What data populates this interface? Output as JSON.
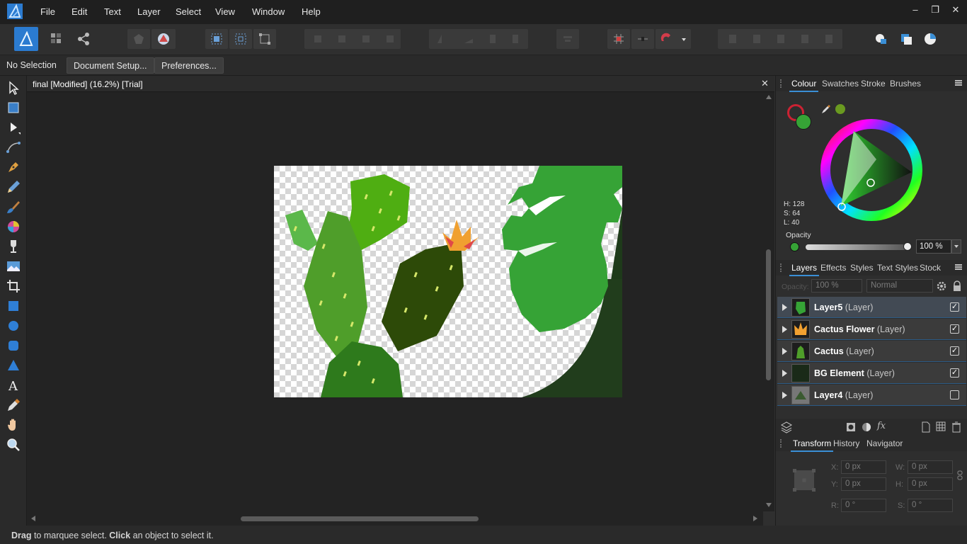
{
  "menu": [
    "File",
    "Edit",
    "Text",
    "Layer",
    "Select",
    "View",
    "Window",
    "Help"
  ],
  "window_controls": {
    "minimize": "–",
    "restore": "❐",
    "close": "✕"
  },
  "context": {
    "selection": "No Selection",
    "doc_setup": "Document Setup...",
    "preferences": "Preferences..."
  },
  "document": {
    "tab_title": "final [Modified] (16.2%) [Trial]",
    "close": "✕"
  },
  "status": {
    "drag": "Drag",
    "text1": " to marquee select. ",
    "click": "Click",
    "text2": " an object to select it."
  },
  "colour_panel": {
    "tabs": [
      "Colour",
      "Swatches",
      "Stroke",
      "Brushes"
    ],
    "h": "H: 128",
    "s": "S: 64",
    "l": "L: 40",
    "opacity_label": "Opacity",
    "opacity_value": "100 %",
    "current_colour": "#36a336"
  },
  "layers_panel": {
    "tabs": [
      "Layers",
      "Effects",
      "Styles",
      "Text Styles",
      "Stock"
    ],
    "opacity_label": "Opacity:",
    "opacity_value": "100 %",
    "blend_mode": "Normal",
    "layers": [
      {
        "name": "Layer5",
        "type": "(Layer)",
        "visible": "✓"
      },
      {
        "name": "Cactus Flower",
        "type": "(Layer)",
        "visible": "✓"
      },
      {
        "name": "Cactus",
        "type": "(Layer)",
        "visible": "✓"
      },
      {
        "name": "BG Element",
        "type": "(Layer)",
        "visible": "✓"
      },
      {
        "name": "Layer4",
        "type": "(Layer)",
        "visible": ""
      }
    ]
  },
  "transform_panel": {
    "tabs": [
      "Transform",
      "History",
      "Navigator"
    ],
    "x_label": "X:",
    "x_value": "0 px",
    "y_label": "Y:",
    "y_value": "0 px",
    "w_label": "W:",
    "w_value": "0 px",
    "h_label": "H:",
    "h_value": "0 px",
    "r_label": "R:",
    "r_value": "0 °",
    "s_label": "S:",
    "s_value": "0 °"
  }
}
